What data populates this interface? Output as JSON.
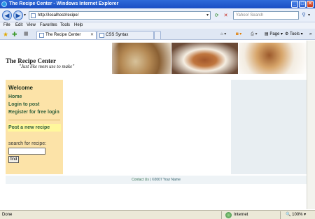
{
  "window": {
    "title": "The Recipe Center - Windows Internet Explorer",
    "minimize": "_",
    "maximize": "□",
    "close": "✕"
  },
  "addressbar": {
    "back_icon": "back-arrow-icon",
    "forward_icon": "forward-arrow-icon",
    "url": "http://localhost/recipe/",
    "search_placeholder": "Yahoo! Search",
    "search_icon": "search-icon"
  },
  "menu": [
    "File",
    "Edit",
    "View",
    "Favorites",
    "Tools",
    "Help"
  ],
  "tabs": [
    {
      "label": "The Recipe Center",
      "active": true
    },
    {
      "label": "CSS Syntax",
      "active": false
    }
  ],
  "commandbar": {
    "page_label": "Page",
    "tools_label": "Tools"
  },
  "site": {
    "title": "The Recipe Center",
    "tagline": "\"Just like mom use to make\""
  },
  "sidebar": {
    "welcome": "Welcome",
    "links": [
      "Home",
      "Login to post",
      "Register for free login"
    ],
    "post_recipe": "Post a new recipe",
    "search_label": "search for recipe:",
    "search_value": "",
    "find_button": "find"
  },
  "footer": {
    "contact": "Contact Us",
    "copyright": "| ©2007 Your Name"
  },
  "statusbar": {
    "status": "Done",
    "zone": "Internet",
    "zoom": "100%"
  }
}
